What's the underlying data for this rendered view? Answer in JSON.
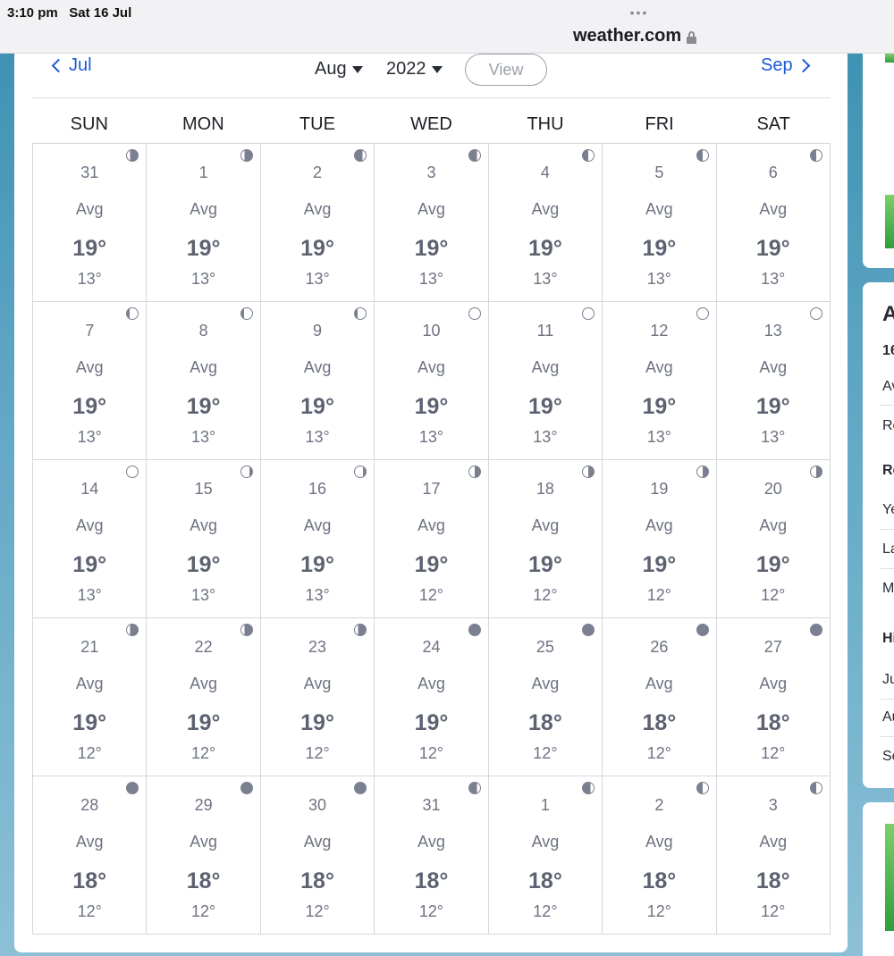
{
  "status_bar": {
    "time": "3:10 pm",
    "date": "Sat 16 Jul"
  },
  "browser": {
    "dots": "•••",
    "url": "weather.com",
    "lock_icon": "lock-icon"
  },
  "nav": {
    "prev_label": "Jul",
    "month": "Aug",
    "year": "2022",
    "view_label": "View",
    "next_label": "Sep"
  },
  "weekdays": [
    "SUN",
    "MON",
    "TUE",
    "WED",
    "THU",
    "FRI",
    "SAT"
  ],
  "days": [
    {
      "date": "31",
      "avg": "Avg",
      "hi": "19°",
      "lo": "13°",
      "moon": "waning-crescent"
    },
    {
      "date": "1",
      "avg": "Avg",
      "hi": "19°",
      "lo": "13°",
      "moon": "waning-crescent"
    },
    {
      "date": "2",
      "avg": "Avg",
      "hi": "19°",
      "lo": "13°",
      "moon": "waxing-crescent"
    },
    {
      "date": "3",
      "avg": "Avg",
      "hi": "19°",
      "lo": "13°",
      "moon": "waxing-crescent"
    },
    {
      "date": "4",
      "avg": "Avg",
      "hi": "19°",
      "lo": "13°",
      "moon": "first-quarter"
    },
    {
      "date": "5",
      "avg": "Avg",
      "hi": "19°",
      "lo": "13°",
      "moon": "first-quarter"
    },
    {
      "date": "6",
      "avg": "Avg",
      "hi": "19°",
      "lo": "13°",
      "moon": "first-quarter"
    },
    {
      "date": "7",
      "avg": "Avg",
      "hi": "19°",
      "lo": "13°",
      "moon": "waxing-gibbous"
    },
    {
      "date": "8",
      "avg": "Avg",
      "hi": "19°",
      "lo": "13°",
      "moon": "waxing-gibbous"
    },
    {
      "date": "9",
      "avg": "Avg",
      "hi": "19°",
      "lo": "13°",
      "moon": "waxing-gibbous"
    },
    {
      "date": "10",
      "avg": "Avg",
      "hi": "19°",
      "lo": "13°",
      "moon": "full"
    },
    {
      "date": "11",
      "avg": "Avg",
      "hi": "19°",
      "lo": "13°",
      "moon": "full"
    },
    {
      "date": "12",
      "avg": "Avg",
      "hi": "19°",
      "lo": "13°",
      "moon": "full"
    },
    {
      "date": "13",
      "avg": "Avg",
      "hi": "19°",
      "lo": "13°",
      "moon": "full"
    },
    {
      "date": "14",
      "avg": "Avg",
      "hi": "19°",
      "lo": "13°",
      "moon": "full"
    },
    {
      "date": "15",
      "avg": "Avg",
      "hi": "19°",
      "lo": "13°",
      "moon": "waning-gibbous"
    },
    {
      "date": "16",
      "avg": "Avg",
      "hi": "19°",
      "lo": "13°",
      "moon": "waning-gibbous"
    },
    {
      "date": "17",
      "avg": "Avg",
      "hi": "19°",
      "lo": "12°",
      "moon": "last-quarter"
    },
    {
      "date": "18",
      "avg": "Avg",
      "hi": "19°",
      "lo": "12°",
      "moon": "last-quarter"
    },
    {
      "date": "19",
      "avg": "Avg",
      "hi": "19°",
      "lo": "12°",
      "moon": "last-quarter"
    },
    {
      "date": "20",
      "avg": "Avg",
      "hi": "19°",
      "lo": "12°",
      "moon": "last-quarter"
    },
    {
      "date": "21",
      "avg": "Avg",
      "hi": "19°",
      "lo": "12°",
      "moon": "waning-crescent"
    },
    {
      "date": "22",
      "avg": "Avg",
      "hi": "19°",
      "lo": "12°",
      "moon": "waning-crescent"
    },
    {
      "date": "23",
      "avg": "Avg",
      "hi": "19°",
      "lo": "12°",
      "moon": "waning-crescent"
    },
    {
      "date": "24",
      "avg": "Avg",
      "hi": "19°",
      "lo": "12°",
      "moon": "new"
    },
    {
      "date": "25",
      "avg": "Avg",
      "hi": "18°",
      "lo": "12°",
      "moon": "new"
    },
    {
      "date": "26",
      "avg": "Avg",
      "hi": "18°",
      "lo": "12°",
      "moon": "new"
    },
    {
      "date": "27",
      "avg": "Avg",
      "hi": "18°",
      "lo": "12°",
      "moon": "new"
    },
    {
      "date": "28",
      "avg": "Avg",
      "hi": "18°",
      "lo": "12°",
      "moon": "new"
    },
    {
      "date": "29",
      "avg": "Avg",
      "hi": "18°",
      "lo": "12°",
      "moon": "new"
    },
    {
      "date": "30",
      "avg": "Avg",
      "hi": "18°",
      "lo": "12°",
      "moon": "new"
    },
    {
      "date": "31",
      "avg": "Avg",
      "hi": "18°",
      "lo": "12°",
      "moon": "waxing-crescent"
    },
    {
      "date": "1",
      "avg": "Avg",
      "hi": "18°",
      "lo": "12°",
      "moon": "waxing-crescent"
    },
    {
      "date": "2",
      "avg": "Avg",
      "hi": "18°",
      "lo": "12°",
      "moon": "first-quarter"
    },
    {
      "date": "3",
      "avg": "Avg",
      "hi": "18°",
      "lo": "12°",
      "moon": "first-quarter"
    }
  ],
  "side_panel": {
    "title": "A",
    "items": [
      "16",
      "Av",
      "Re",
      "Re",
      "Ye",
      "La",
      "M",
      "Hi",
      "Ju",
      "Au",
      "Se"
    ]
  },
  "colors": {
    "link": "#1b5bd6",
    "text_muted": "#6e7382",
    "accent_green": "#2f9e3c"
  }
}
